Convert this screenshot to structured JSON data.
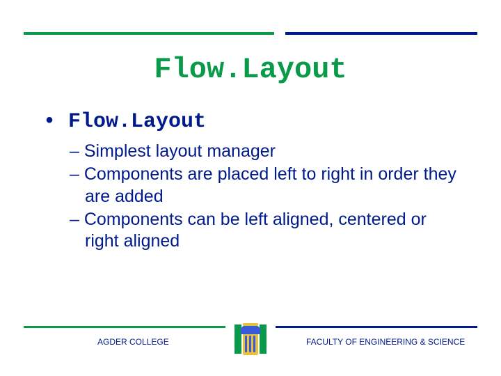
{
  "title": "Flow.Layout",
  "main_bullet": "Flow.Layout",
  "sub_bullets": [
    "Simplest layout manager",
    "Components are placed left to right in order they are added",
    "Components can be left aligned, centered or right aligned"
  ],
  "footer": {
    "left": "AGDER COLLEGE",
    "right": "FACULTY OF ENGINEERING & SCIENCE"
  },
  "colors": {
    "green": "#0a9b4a",
    "blue": "#001a8c"
  }
}
